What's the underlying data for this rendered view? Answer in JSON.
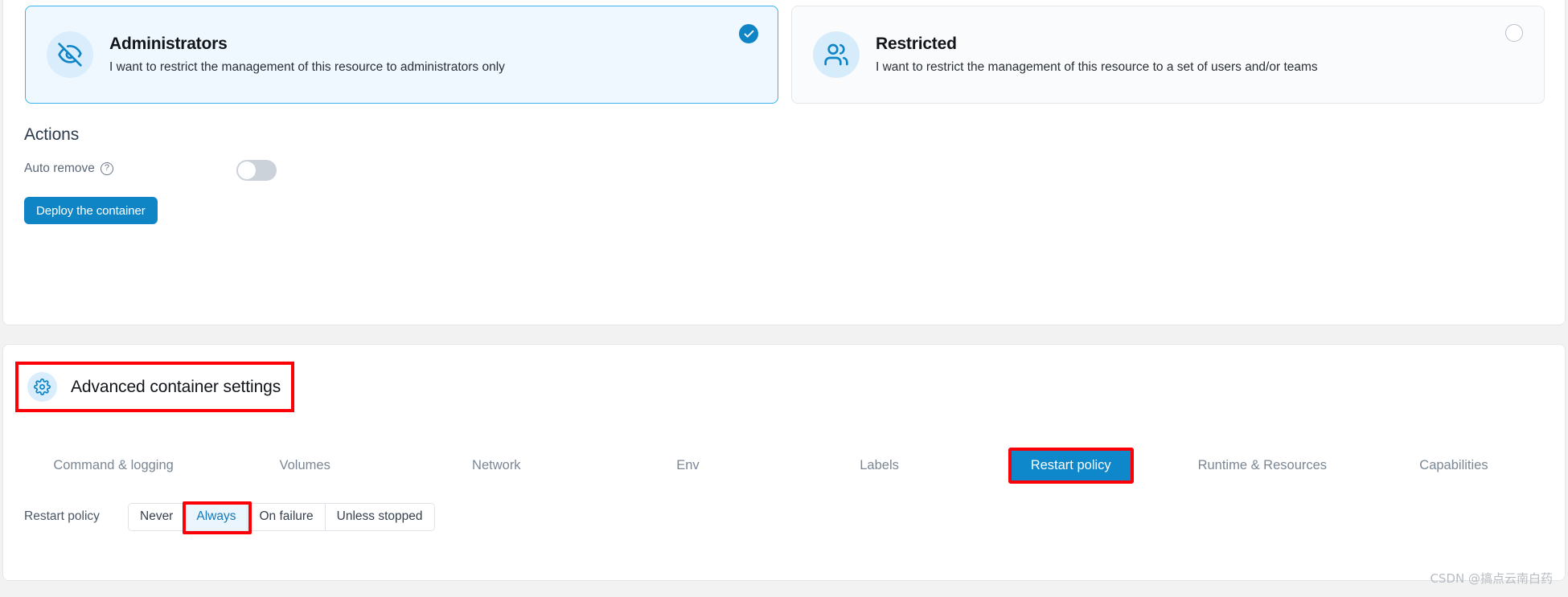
{
  "access_cards": [
    {
      "id": "administrators",
      "icon": "eye-off-icon",
      "title": "Administrators",
      "description": "I want to restrict the management of this resource to administrators only",
      "selected": true
    },
    {
      "id": "restricted",
      "icon": "users-icon",
      "title": "Restricted",
      "description": "I want to restrict the management of this resource to a set of users and/or teams",
      "selected": false
    }
  ],
  "actions": {
    "heading": "Actions",
    "auto_remove": {
      "label": "Auto remove",
      "help_icon": "question-mark-icon",
      "toggle_state": "off"
    },
    "deploy_button": "Deploy the container"
  },
  "advanced": {
    "icon": "gear-icon",
    "title": "Advanced container settings",
    "tabs": [
      {
        "label": "Command & logging",
        "active": false
      },
      {
        "label": "Volumes",
        "active": false
      },
      {
        "label": "Network",
        "active": false
      },
      {
        "label": "Env",
        "active": false
      },
      {
        "label": "Labels",
        "active": false
      },
      {
        "label": "Restart policy",
        "active": true
      },
      {
        "label": "Runtime & Resources",
        "active": false
      },
      {
        "label": "Capabilities",
        "active": false
      }
    ],
    "restart_policy": {
      "label": "Restart policy",
      "options": [
        {
          "label": "Never",
          "selected": false
        },
        {
          "label": "Always",
          "selected": true
        },
        {
          "label": "On failure",
          "selected": false
        },
        {
          "label": "Unless stopped",
          "selected": false
        }
      ]
    }
  },
  "watermark": "CSDN @搞点云南白药",
  "colors": {
    "accent": "#1085c6",
    "tab_active_bg": "#0f87cb",
    "highlight_red": "#fb0007",
    "selected_card_bg": "#f0f8ff",
    "selected_card_border": "#3ab4ea",
    "icon_circle_bg": "#d9edfc",
    "segment_selected_bg": "#eaf5fd",
    "segment_selected_text": "#1577b8"
  }
}
